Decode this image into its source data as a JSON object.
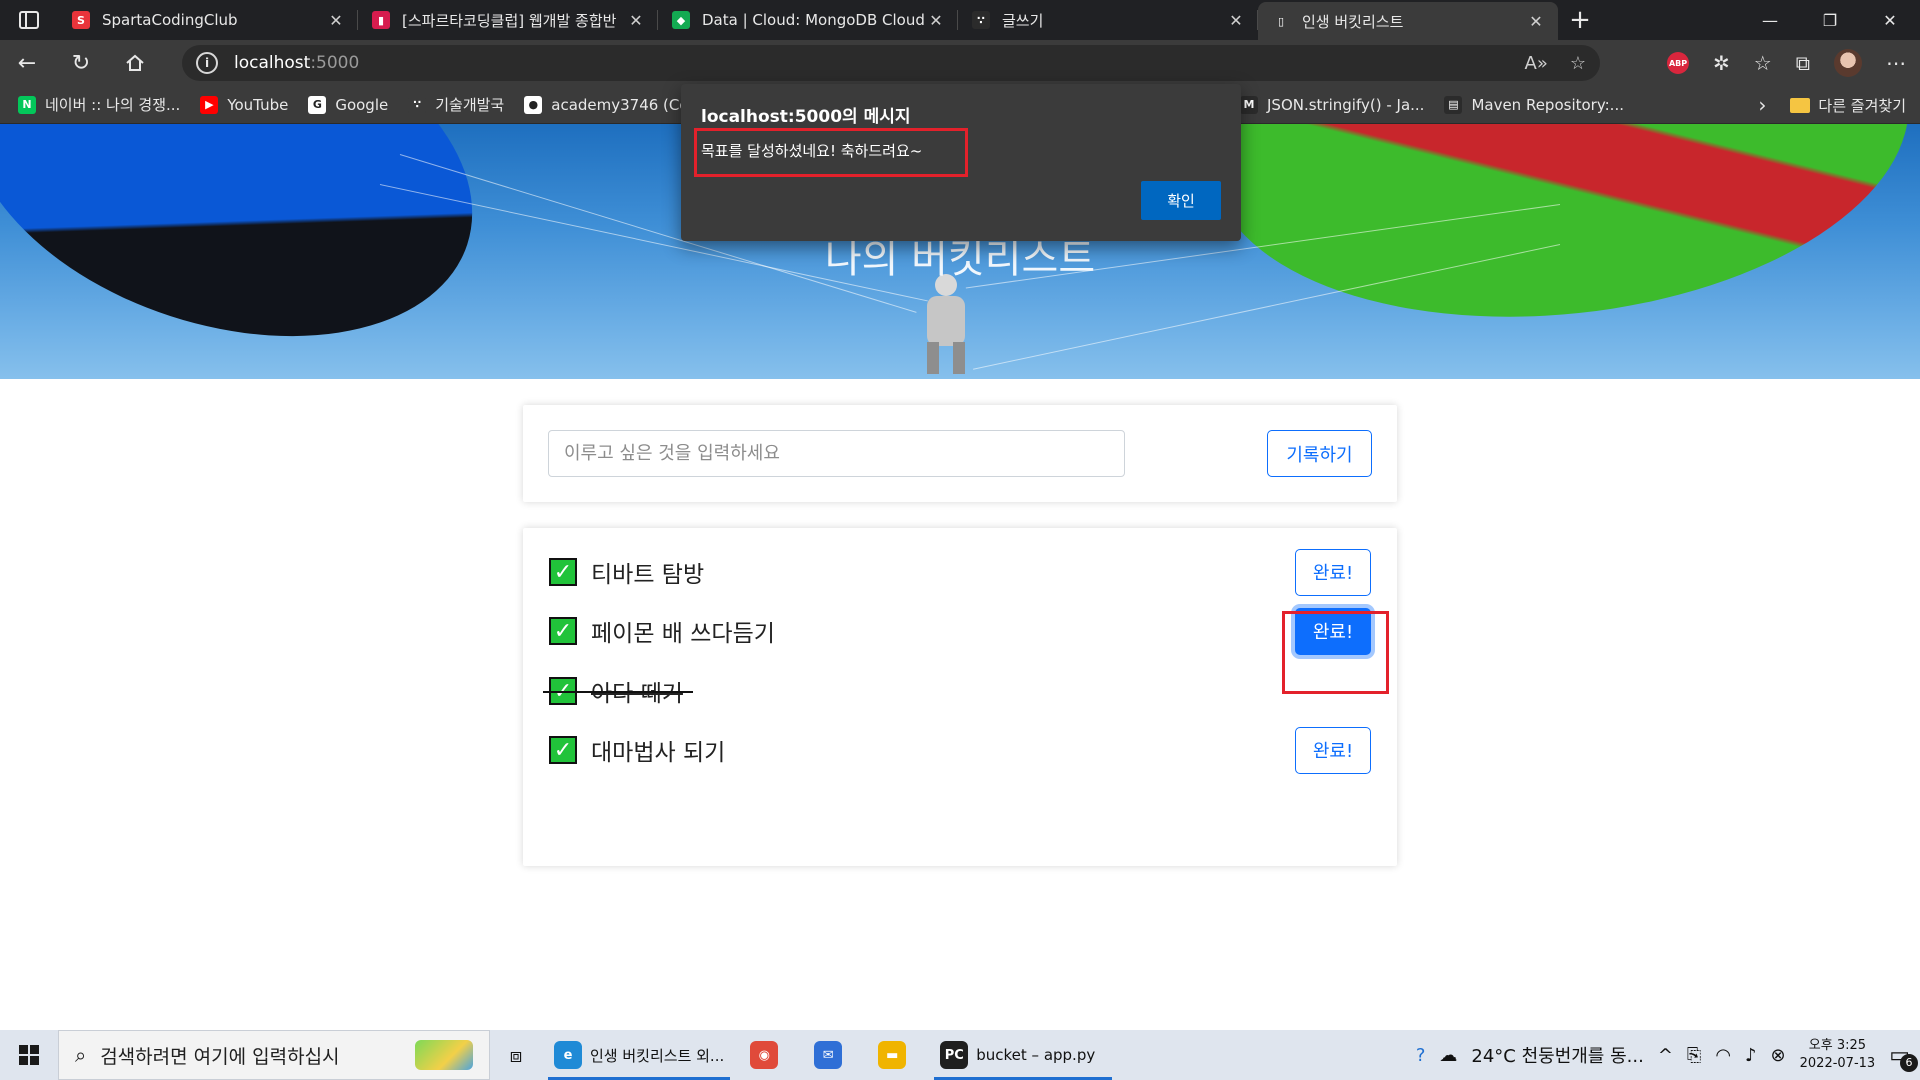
{
  "browser": {
    "tabs": [
      {
        "title": "SpartaCodingClub",
        "icon_color": "#e8343b",
        "icon": "S"
      },
      {
        "title": "[스파르타코딩클럽] 웹개발 종합반",
        "icon_color": "#d61c4e",
        "icon": "▮"
      },
      {
        "title": "Data | Cloud: MongoDB Cloud",
        "icon_color": "#13aa52",
        "icon": "◆"
      },
      {
        "title": "글쓰기",
        "icon_color": "#2b2b2b",
        "icon": "∵"
      },
      {
        "title": "인생 버킷리스트",
        "icon_color": "#3b3b3b",
        "icon": "▯",
        "active": true
      }
    ],
    "address": {
      "host": "localhost",
      "port": ":5000"
    },
    "bookmarks": [
      {
        "label": "네이버 :: 나의 경쟁...",
        "icon": "N",
        "color": "#03c75a"
      },
      {
        "label": "YouTube",
        "icon": "▶",
        "color": "#ff0000"
      },
      {
        "label": "Google",
        "icon": "G",
        "color": "#ffffff"
      },
      {
        "label": "기술개발국",
        "icon": "∵",
        "color": "#3b3b3b"
      },
      {
        "label": "academy3746 (Co",
        "icon": "●",
        "color": "#ffffff"
      }
    ],
    "bookmarks_right": [
      {
        "label": "JSON.stringify() - Ja...",
        "icon": "M"
      },
      {
        "label": "Maven Repository:...",
        "icon": "▤"
      }
    ],
    "other_bookmarks": "다른 즐겨찾기"
  },
  "page": {
    "hero_title": "나의 버킷리스트",
    "input_placeholder": "이루고 싶은 것을 입력하세요",
    "save_label": "기록하기",
    "items": [
      {
        "text": "티바트 탐방",
        "done": false,
        "button": "완료!"
      },
      {
        "text": "페이몬 배 쓰다듬기",
        "done": false,
        "button": "완료!"
      },
      {
        "text": "아다 떼기",
        "done": true,
        "button": ""
      },
      {
        "text": "대마법사 되기",
        "done": false,
        "button": "완료!"
      }
    ]
  },
  "dialog": {
    "title": "localhost:5000의 메시지",
    "message": "목표를 달성하셨네요! 축하드려요~",
    "ok_label": "확인"
  },
  "taskbar": {
    "search_placeholder": "검색하려면 여기에 입력하십시",
    "apps": [
      {
        "label": "인생 버킷리스트 외...",
        "icon": "e",
        "color": "#1f8ad6",
        "open": true
      },
      {
        "label": "",
        "icon": "◉",
        "color": "#e04a3a",
        "open": false
      },
      {
        "label": "",
        "icon": "✉",
        "color": "#2f6fd6",
        "open": false
      },
      {
        "label": "",
        "icon": "▬",
        "color": "#f0b400",
        "open": false
      },
      {
        "label": "bucket – app.py",
        "icon": "PC",
        "color": "#1f1f1f",
        "open": true
      }
    ],
    "weather": "24°C  천둥번개를 동...",
    "time": "오후 3:25",
    "date": "2022-07-13",
    "notifications": "6"
  }
}
